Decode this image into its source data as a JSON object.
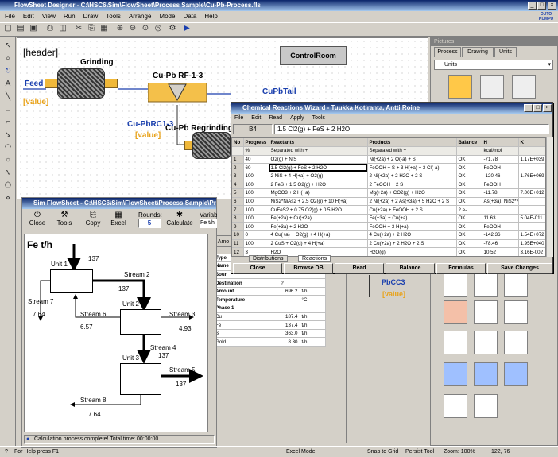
{
  "main": {
    "title": "FlowSheet Designer - C:\\HSC6\\Sim\\FlowSheet\\Process Sample\\Cu-Pb-Process.fls",
    "menu": [
      "File",
      "Edit",
      "View",
      "Run",
      "Draw",
      "Tools",
      "Arrange",
      "Mode",
      "Data",
      "Help"
    ],
    "brand": "OUTO KUMPU"
  },
  "canvas": {
    "header": "[header]",
    "grinding": "Grinding",
    "rf": "Cu-Pb RF-1-3",
    "regrinding": "Cu-Pb Regrinding",
    "feed": "Feed",
    "feed_value": "[value]",
    "cupbtail": "CuPbTail",
    "rc": "Cu-PbRC1-3",
    "rc_value": "[value]",
    "control": "ControlRoom",
    "pbcc3": "PbCC3",
    "pbcc3_value": "[value]"
  },
  "pictures": {
    "title": "Pictures",
    "tabs": [
      "Process",
      "Drawing",
      "Units"
    ],
    "select": "Units"
  },
  "wizard": {
    "title": "Chemical Reactions Wizard - Tuukka Kotiranta, Antti Roine",
    "menu": [
      "File",
      "Edit",
      "Read",
      "Apply",
      "Tools"
    ],
    "cell_ref": "B4",
    "formula": "1.5 Cl2(g) + FeS + 2 H2O",
    "headers": [
      "No",
      "Progress",
      "Reactants",
      "Products",
      "Balance",
      "H",
      "K"
    ],
    "subheaders": [
      "",
      "%",
      "Separated with +",
      "Separated with +",
      "",
      "kcal/mol",
      ""
    ],
    "rows": [
      [
        "1",
        "40",
        "O2(g) + NiS",
        "Ni(+2a) + 2 O(-a) + S",
        "OK",
        "-71.78",
        "1.17E+039"
      ],
      [
        "2",
        "60",
        "1.5 Cl2(g) + FeS + 2 H2O",
        "FeOOH + S + 3 H(+a) + 3 Cl(-a)",
        "OK",
        "FeOOH",
        ""
      ],
      [
        "3",
        "100",
        "2 NiS + 4 H(+a) + O2(g)",
        "2 Ni(+2a) + 2 H2O + 2 S",
        "OK",
        "-120.46",
        "1.76E+069"
      ],
      [
        "4",
        "100",
        "2 FeS + 1.5 O2(g) + H2O",
        "2 FeOOH + 2 S",
        "OK",
        "FeOOH",
        ""
      ],
      [
        "5",
        "100",
        "MgCO3 + 2 H(+a)",
        "Mg(+2a) + CO2(g) + H2O",
        "OK",
        "-11.78",
        "7.00E+012"
      ],
      [
        "6",
        "100",
        "NiS2*NiAs2 + 2.5 O2(g) + 10 H(+a)",
        "2 Ni(+2a) + 2 As(+3a) + 5 H2O + 2 S",
        "OK",
        "As(+3a), NiS2*NiAs2",
        ""
      ],
      [
        "7",
        "100",
        "CuFeS2 + 0.75 O2(g) + 0.5 H2O",
        "Cu(+2a) + FeOOH + 2 S",
        "2 e-",
        "",
        ""
      ],
      [
        "8",
        "100",
        "Fe(+2a) + Cu(+2a)",
        "Fe(+3a) + Cu(+a)",
        "OK",
        "11.63",
        "5.04E-011"
      ],
      [
        "9",
        "100",
        "Fe(+3a) + 2 H2O",
        "FeOOH + 3 H(+a)",
        "OK",
        "FeOOH",
        ""
      ],
      [
        "10",
        "0",
        "4 Cu(+a) + O2(g) + 4 H(+a)",
        "4 Cu(+2a) + 2 H2O",
        "OK",
        "-142.36",
        "1.54E+072"
      ],
      [
        "11",
        "100",
        "2 CuS + O2(g) + 4 H(+a)",
        "2 Cu(+2a) + 2 H2O + 2 S",
        "OK",
        "-78.46",
        "1.95E+040"
      ],
      [
        "12",
        "3",
        "H2O",
        "H2O(g)",
        "OK",
        "10.52",
        "3.16E-002"
      ]
    ],
    "tabs": [
      "Distributions",
      "Reactions"
    ],
    "buttons": [
      "Close",
      "Browse DB",
      "Read",
      "Balance",
      "Formulas",
      "Save Changes"
    ]
  },
  "sim": {
    "title": "Sim FlowSheet - C:\\HSC6\\Sim\\FlowSheet\\Process Sample\\Process Sample",
    "tools": [
      "Close",
      "Tools",
      "Copy",
      "Excel"
    ],
    "rounds_label": "Rounds:",
    "rounds": "5",
    "calc": "Calculate",
    "varsel": "Variable Select",
    "varsel_value": "Fe t/h",
    "chart_title": "Fe t/h",
    "units": [
      "Unit  1",
      "Unit  2",
      "Unit  3"
    ],
    "streams": [
      {
        "name": "",
        "value": "137"
      },
      {
        "name": "Stream  2",
        "value": "137"
      },
      {
        "name": "Stream  3",
        "value": "4.93"
      },
      {
        "name": "Stream  4",
        "value": "137"
      },
      {
        "name": "Stream  5",
        "value": "137"
      },
      {
        "name": "Stream  6",
        "value": "6.57"
      },
      {
        "name": "Stream  7",
        "value": "7.64"
      },
      {
        "name": "Stream  8",
        "value": "7.64"
      }
    ],
    "status": "Calculation process complete!  Total time: 00:00:00",
    "amount_tab": "Amo"
  },
  "props": {
    "type": "Type",
    "name": "Name",
    "source": "Sour",
    "destination": "Destination",
    "dest_value": "?",
    "rows": [
      [
        "Amount",
        "696.2",
        "t/h"
      ],
      [
        "Temperature",
        "",
        "°C"
      ],
      [
        "Phase 1",
        "",
        ""
      ],
      [
        "Cu",
        "187.4",
        "t/h"
      ],
      [
        "Fe",
        "137.4",
        "t/h"
      ],
      [
        "S",
        "363.0",
        "t/h"
      ],
      [
        "Gold",
        "8.30",
        "t/h"
      ]
    ]
  },
  "status": {
    "help": "For Help press F1",
    "excel": "Excel Mode",
    "snap": "Snap to Grid",
    "persist": "Persist Tool",
    "zoom": "Zoom: 100%",
    "coords": "122, 76"
  }
}
